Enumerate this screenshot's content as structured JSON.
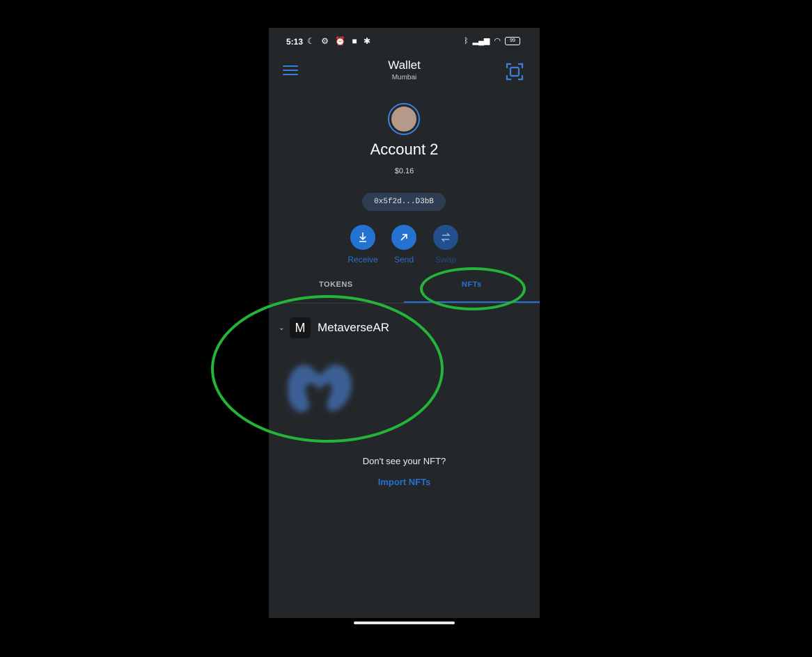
{
  "status_bar": {
    "time": "5:13",
    "battery": "99"
  },
  "header": {
    "title": "Wallet",
    "network": "Mumbai",
    "menu_icon": "hamburger-menu-icon",
    "scan_icon": "qr-scan-icon"
  },
  "account": {
    "name": "Account 2",
    "balance": "$0.16",
    "address": "0x5f2d...D3bB"
  },
  "actions": [
    {
      "label": "Receive",
      "icon": "download-arrow-icon"
    },
    {
      "label": "Send",
      "icon": "arrow-up-right-icon"
    },
    {
      "label": "Swap",
      "icon": "swap-icon"
    }
  ],
  "tabs": [
    {
      "label": "TOKENS",
      "active": false
    },
    {
      "label": "NFTs",
      "active": true
    }
  ],
  "collection": {
    "initial": "M",
    "name": "MetaverseAR"
  },
  "empty_prompt": {
    "question": "Don't see your NFT?",
    "link": "Import NFTs"
  },
  "colors": {
    "accent": "#2473d3",
    "annotation": "#25b43a",
    "background": "#24272a"
  }
}
